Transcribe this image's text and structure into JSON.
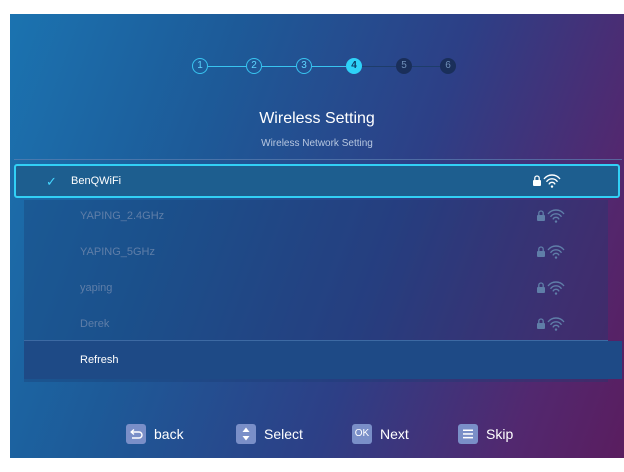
{
  "steps": [
    "1",
    "2",
    "3",
    "4",
    "5",
    "6"
  ],
  "current_step": 4,
  "header": {
    "title": "Wireless Setting",
    "subtitle": "Wireless Network Setting"
  },
  "networks": [
    {
      "name": "BenQWiFi",
      "selected": true,
      "secured": true
    },
    {
      "name": "YAPING_2.4GHz",
      "selected": false,
      "secured": true
    },
    {
      "name": "YAPING_5GHz",
      "selected": false,
      "secured": true
    },
    {
      "name": "yaping",
      "selected": false,
      "secured": true
    },
    {
      "name": "Derek",
      "selected": false,
      "secured": true
    }
  ],
  "refresh_label": "Refresh",
  "footer": {
    "back_label": "back",
    "select_label": "Select",
    "next_key": "OK",
    "next_label": "Next",
    "skip_label": "Skip"
  },
  "colors": {
    "accent": "#32d0f6",
    "key_bg": "#7a8fc8"
  }
}
